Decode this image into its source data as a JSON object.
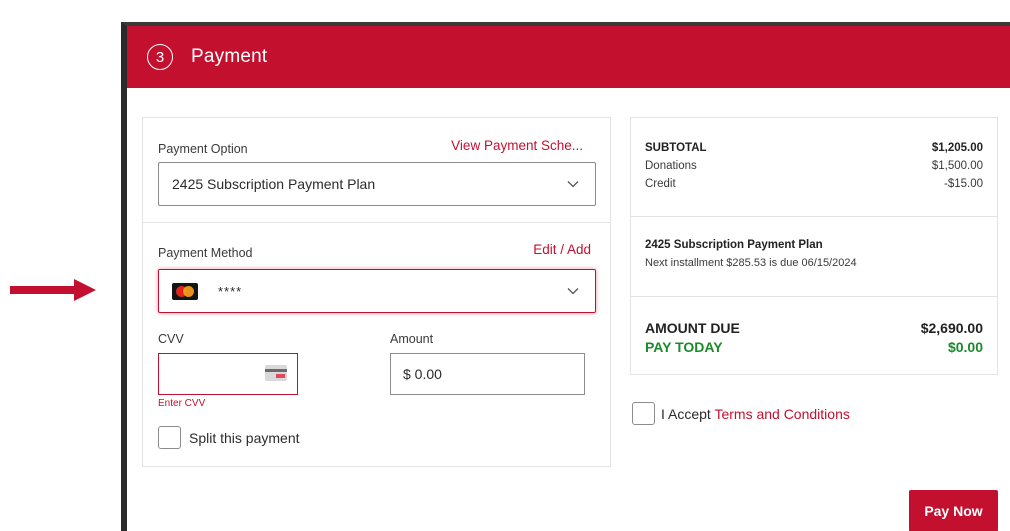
{
  "header": {
    "step": "3",
    "title": "Payment"
  },
  "payment_option": {
    "label": "Payment Option",
    "link": "View Payment Sche...",
    "selected": "2425 Subscription Payment Plan"
  },
  "payment_method": {
    "label": "Payment Method",
    "link": "Edit / Add",
    "card_masked": "****",
    "card_icon": "mastercard-icon"
  },
  "cvv": {
    "label": "CVV",
    "value": "",
    "error": "Enter CVV"
  },
  "amount": {
    "label": "Amount",
    "value": "$ 0.00"
  },
  "split": {
    "label": "Split this payment",
    "checked": false
  },
  "summary": {
    "subtotal_label": "SUBTOTAL",
    "subtotal_value": "$1,205.00",
    "donations_label": "Donations",
    "donations_value": "$1,500.00",
    "credit_label": "Credit",
    "credit_value": "-$15.00",
    "plan_title": "2425 Subscription Payment Plan",
    "plan_note": "Next installment $285.53 is due 06/15/2024",
    "amount_due_label": "AMOUNT DUE",
    "amount_due_value": "$2,690.00",
    "pay_today_label": "PAY TODAY",
    "pay_today_value": "$0.00"
  },
  "terms": {
    "prefix": "I Accept ",
    "link": "Terms and Conditions",
    "checked": false
  },
  "pay_button": "Pay Now",
  "colors": {
    "brand": "#c4102f",
    "success": "#1a8a2a",
    "text": "#2b2b2b"
  }
}
